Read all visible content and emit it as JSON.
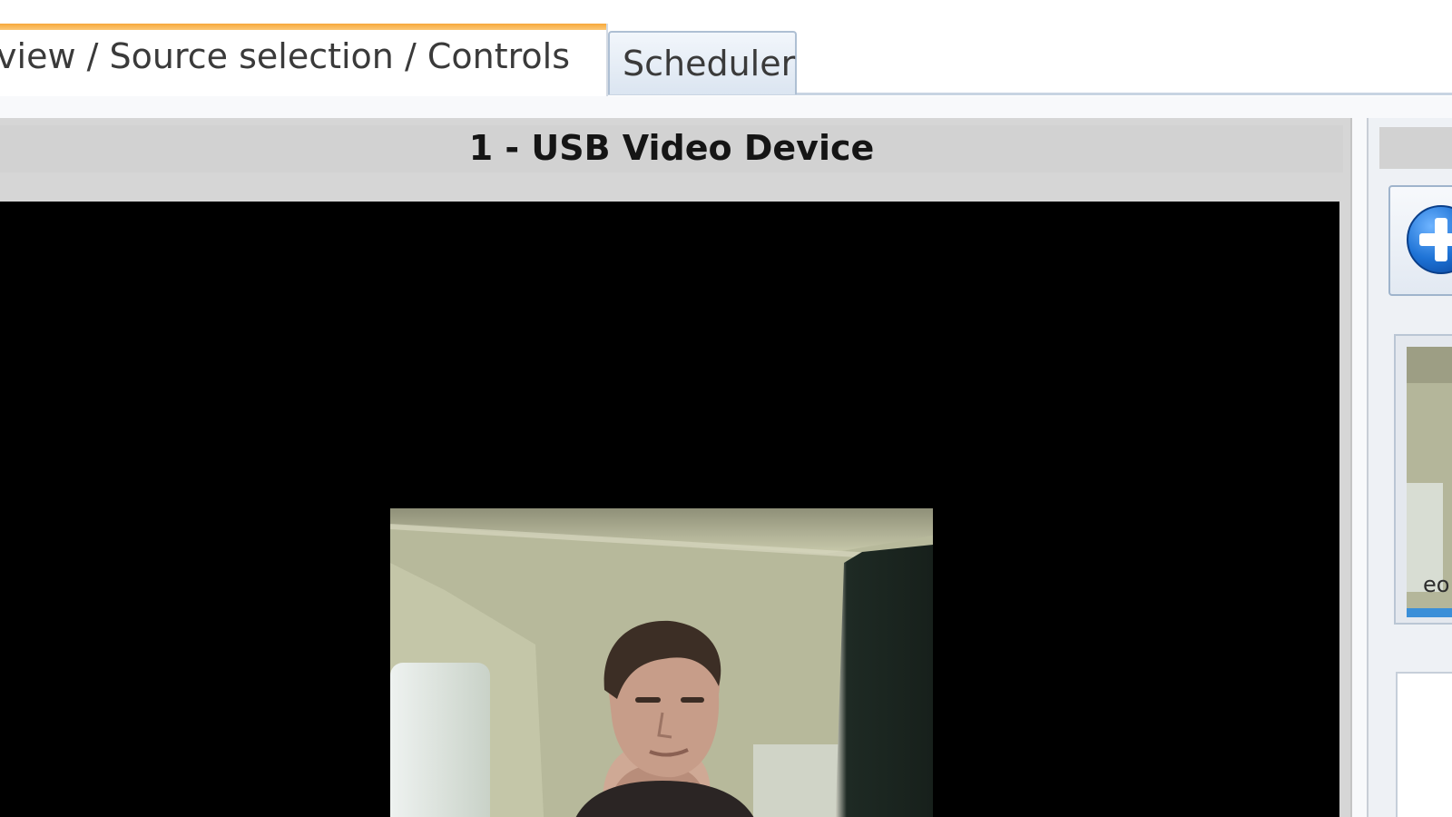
{
  "tabs": [
    {
      "label": "ve view / Source selection / Controls",
      "active": true
    },
    {
      "label": "Scheduler",
      "active": false
    }
  ],
  "video_panel": {
    "title": "1 - USB Video Device",
    "feed_description": "live webcam feed"
  },
  "sidebar": {
    "add_button_icon": "plus-circle-icon",
    "thumbnail_caption": "eo"
  },
  "colors": {
    "active_tab_accent": "#f7a83a",
    "video_background": "#000000",
    "panel_header": "#d2d2d2",
    "add_icon_blue": "#1e73d6",
    "progress_blue": "#3b8fd8"
  }
}
